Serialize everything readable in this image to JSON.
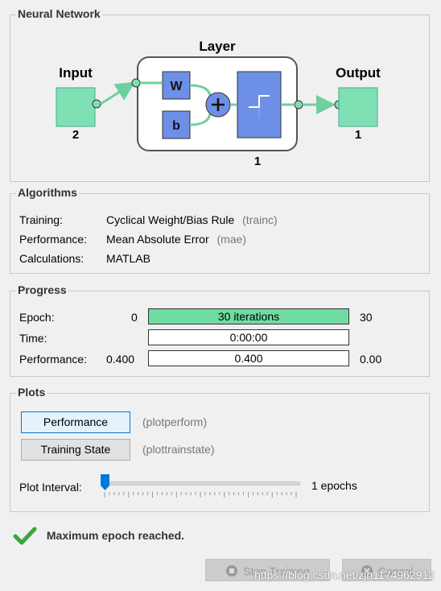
{
  "network": {
    "section_title": "Neural Network",
    "layer_label": "Layer",
    "input_label": "Input",
    "input_size": "2",
    "output_label": "Output",
    "output_size": "1",
    "weight_label": "W",
    "bias_label": "b",
    "layer_size": "1"
  },
  "algorithms": {
    "section_title": "Algorithms",
    "rows": [
      {
        "label": "Training:",
        "value": "Cyclical Weight/Bias Rule",
        "code": "(trainc)"
      },
      {
        "label": "Performance:",
        "value": "Mean Absolute Error",
        "code": "(mae)"
      },
      {
        "label": "Calculations:",
        "value": "MATLAB",
        "code": ""
      }
    ]
  },
  "progress": {
    "section_title": "Progress",
    "epoch": {
      "label": "Epoch:",
      "min": "0",
      "text": "30 iterations",
      "max": "30",
      "fill": 1.0
    },
    "time": {
      "label": "Time:",
      "text": "0:00:00"
    },
    "performance": {
      "label": "Performance:",
      "min": "0.400",
      "text": "0.400",
      "max": "0.00"
    }
  },
  "plots": {
    "section_title": "Plots",
    "performance_button": "Performance",
    "performance_code": "(plotperform)",
    "training_state_button": "Training State",
    "training_state_code": "(plottrainstate)",
    "interval_label": "Plot Interval:",
    "interval_value": "1 epochs",
    "slider_level": 0
  },
  "status": {
    "message": "Maximum epoch reached."
  },
  "buttons": {
    "stop_training": "Stop Training",
    "cancel": "Cancel"
  },
  "watermark": "https://blog.csdn.net/zjn1174962912",
  "colors": {
    "node_green": "#7fe0b4",
    "block_blue": "#6e8fe6",
    "progress_fill": "#6fdca2",
    "check_green": "#3aa53a"
  }
}
